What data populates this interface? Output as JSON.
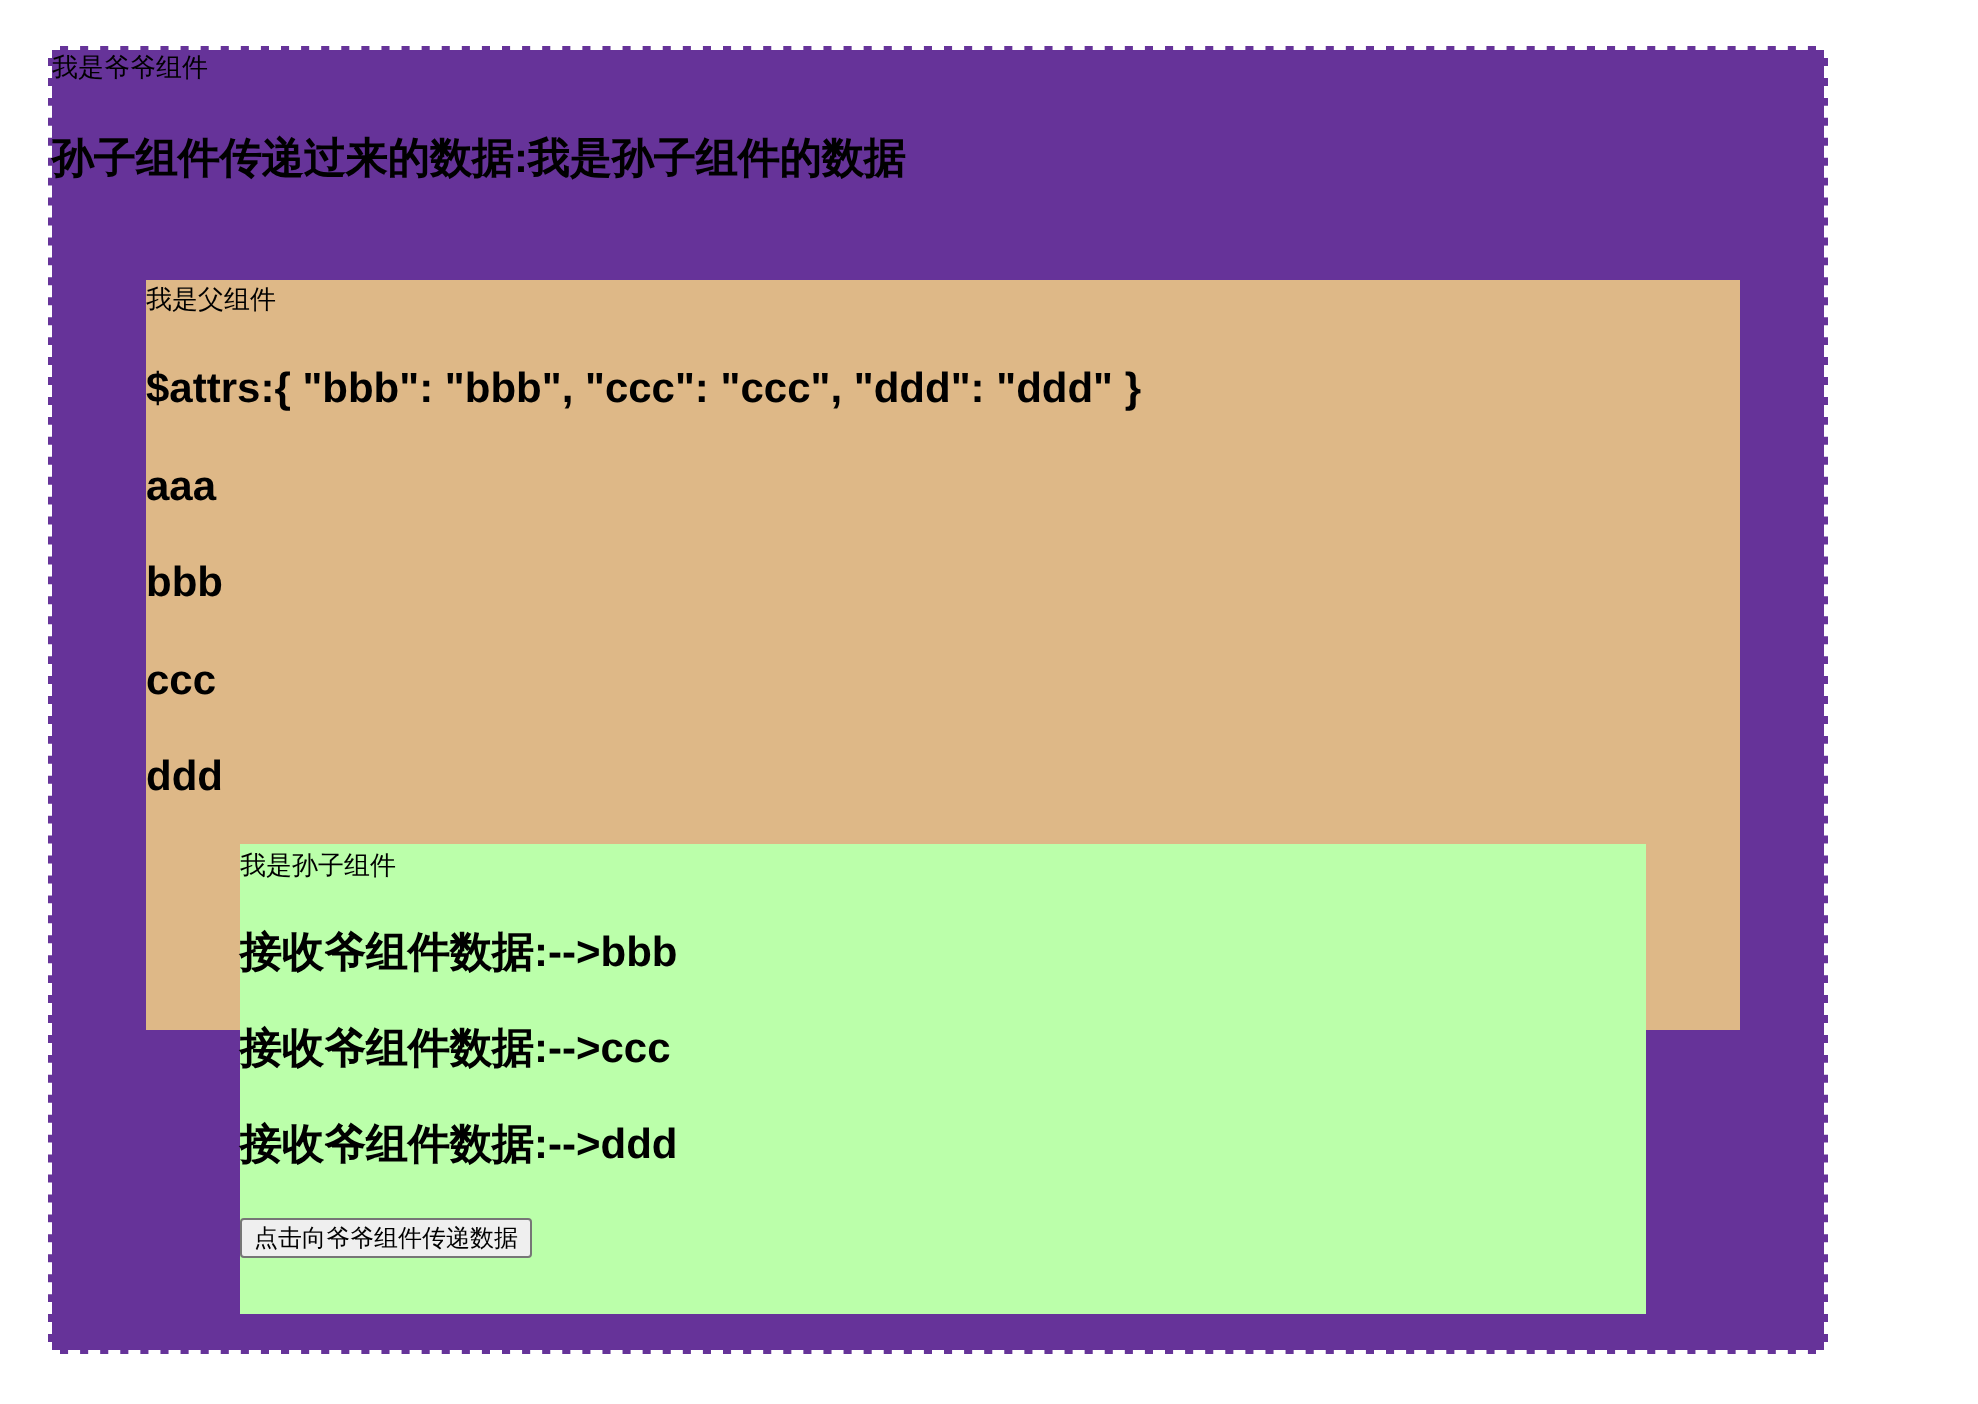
{
  "grandparent": {
    "label": "我是爷爷组件",
    "received": "孙子组件传递过来的数据:我是孙子组件的数据"
  },
  "parent": {
    "label": "我是父组件",
    "attrs": "$attrs:{ \"bbb\": \"bbb\", \"ccc\": \"ccc\", \"ddd\": \"ddd\" }",
    "values": [
      "aaa",
      "bbb",
      "ccc",
      "ddd"
    ]
  },
  "child": {
    "label": "我是孙子组件",
    "lines": [
      "接收爷组件数据:-->bbb",
      "接收爷组件数据:-->ccc",
      "接收爷组件数据:-->ddd"
    ],
    "button": "点击向爷爷组件传递数据"
  }
}
